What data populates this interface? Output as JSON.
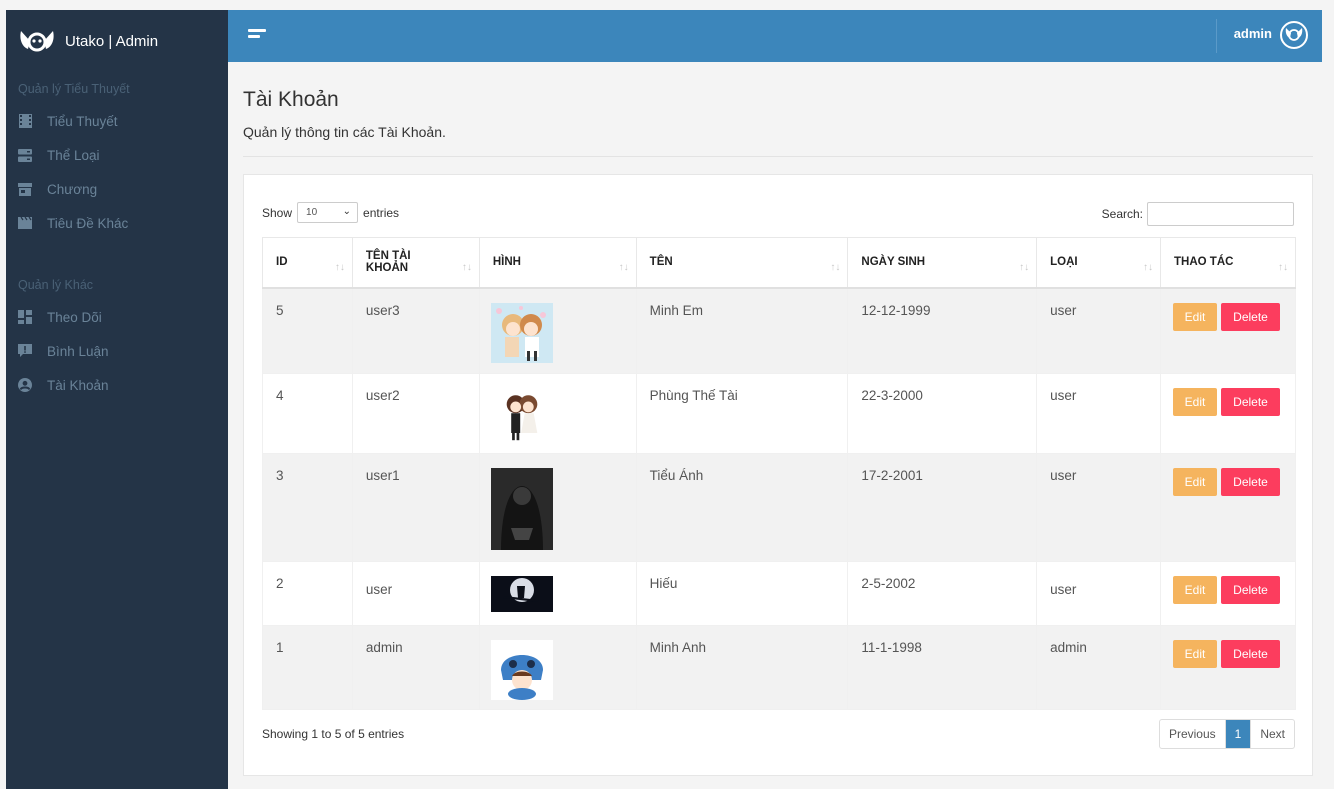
{
  "brand": {
    "title": "Utako | Admin"
  },
  "sidebar": {
    "section1": "Quản lý Tiểu Thuyết",
    "items1": [
      {
        "label": "Tiểu Thuyết",
        "icon": "film-icon"
      },
      {
        "label": "Thể Loại",
        "icon": "server-icon"
      },
      {
        "label": "Chương",
        "icon": "store-icon"
      },
      {
        "label": "Tiêu Đề Khác",
        "icon": "clapperboard-icon"
      }
    ],
    "section2": "Quản lý Khác",
    "items2": [
      {
        "label": "Theo Dõi",
        "icon": "dashboard-icon"
      },
      {
        "label": "Bình Luận",
        "icon": "comment-alert-icon"
      },
      {
        "label": "Tài Khoản",
        "icon": "user-circle-icon"
      }
    ]
  },
  "topbar": {
    "user": "admin"
  },
  "page": {
    "title": "Tài Khoản",
    "subtitle": "Quản lý thông tin các Tài Khoản."
  },
  "table_controls": {
    "show_label": "Show",
    "entries_value": "10",
    "entries_label": "entries",
    "search_label": "Search:",
    "search_value": ""
  },
  "table": {
    "headers": [
      "ID",
      "TÊN TÀI KHOẢN",
      "HÌNH",
      "TÊN",
      "NGÀY SINH",
      "LOẠI",
      "THAO TÁC"
    ],
    "rows": [
      {
        "id": "5",
        "username": "user3",
        "name": "Minh Em",
        "dob": "12-12-1999",
        "type": "user",
        "image": "couple-anime"
      },
      {
        "id": "4",
        "username": "user2",
        "name": "Phùng Thế Tài",
        "dob": "22-3-2000",
        "type": "user",
        "image": "wedding-chibi"
      },
      {
        "id": "3",
        "username": "user1",
        "name": "Tiểu Ánh",
        "dob": "17-2-2001",
        "type": "user",
        "image": "dark-figure"
      },
      {
        "id": "2",
        "username": "user",
        "name": "Hiếu",
        "dob": "2-5-2002",
        "type": "user",
        "image": "moon-witch"
      },
      {
        "id": "1",
        "username": "admin",
        "name": "Minh Anh",
        "dob": "11-1-1998",
        "type": "admin",
        "image": "stitch-kid"
      }
    ],
    "edit_label": "Edit",
    "delete_label": "Delete"
  },
  "footer": {
    "info": "Showing 1 to 5 of 5 entries",
    "prev": "Previous",
    "page": "1",
    "next": "Next"
  },
  "colors": {
    "sidebar": "#243447",
    "topbar": "#3c86bb",
    "edit": "#f5b45e",
    "delete": "#fc3d5e"
  }
}
